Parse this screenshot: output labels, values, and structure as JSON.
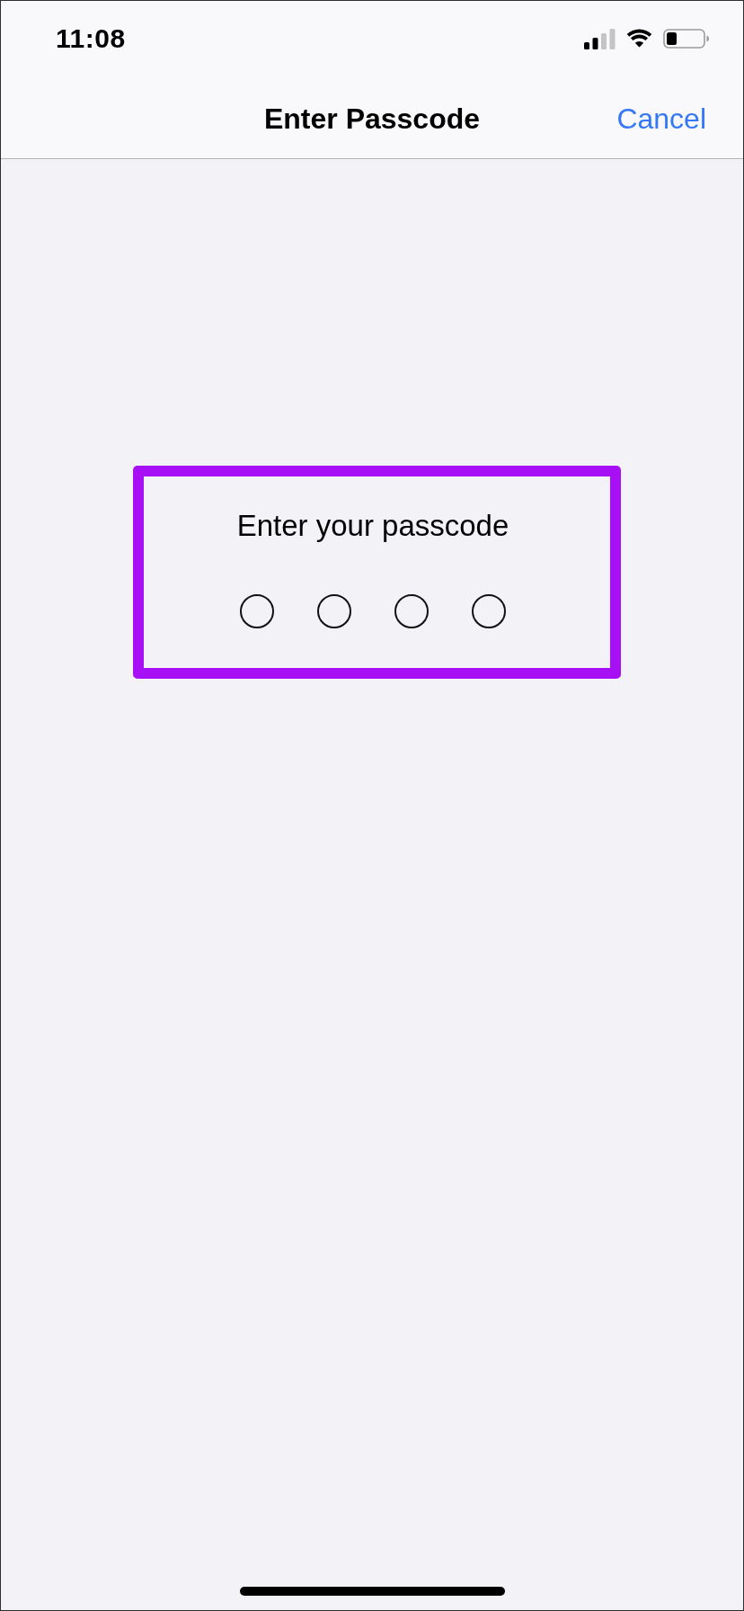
{
  "status_bar": {
    "time": "11:08"
  },
  "nav_bar": {
    "title": "Enter Passcode",
    "cancel": "Cancel"
  },
  "passcode_prompt": {
    "highlighted": true,
    "text": "Enter your passcode",
    "digits": [
      {
        "filled": false
      },
      {
        "filled": false
      },
      {
        "filled": false
      },
      {
        "filled": false
      }
    ]
  }
}
